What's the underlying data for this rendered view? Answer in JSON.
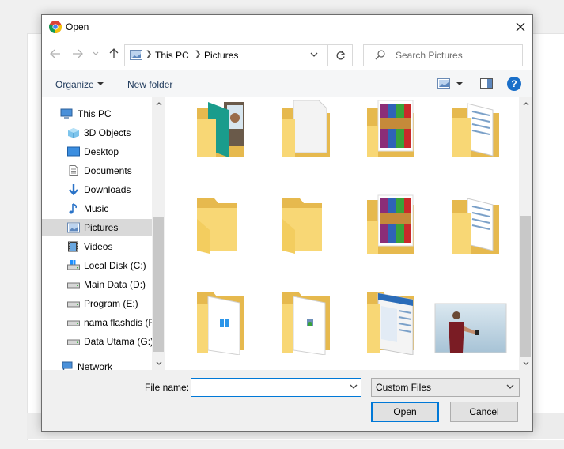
{
  "window": {
    "title": "Open",
    "close_glyph": "✕"
  },
  "nav": {
    "breadcrumb": [
      "This PC",
      "Pictures"
    ],
    "search_placeholder": "Search Pictures"
  },
  "toolbar": {
    "organize": "Organize",
    "new_folder": "New folder",
    "help_glyph": "?"
  },
  "sidebar": {
    "items": [
      {
        "label": "This PC",
        "icon": "computer-icon"
      },
      {
        "label": "3D Objects",
        "icon": "cube-icon"
      },
      {
        "label": "Desktop",
        "icon": "desktop-icon"
      },
      {
        "label": "Documents",
        "icon": "document-icon"
      },
      {
        "label": "Downloads",
        "icon": "download-arrow-icon"
      },
      {
        "label": "Music",
        "icon": "music-note-icon"
      },
      {
        "label": "Pictures",
        "icon": "picture-icon",
        "selected": true
      },
      {
        "label": "Videos",
        "icon": "film-icon"
      },
      {
        "label": "Local Disk (C:)",
        "icon": "windows-drive-icon"
      },
      {
        "label": "Main Data (D:)",
        "icon": "drive-icon"
      },
      {
        "label": "Program (E:)",
        "icon": "drive-icon"
      },
      {
        "label": "nama flashdis (F",
        "icon": "drive-icon"
      },
      {
        "label": "Data Utama (G:)",
        "icon": "drive-icon"
      },
      {
        "label": "Network",
        "icon": "network-icon"
      }
    ]
  },
  "files": [
    {
      "kind": "folder-teal-photo"
    },
    {
      "kind": "folder-white-page"
    },
    {
      "kind": "folder-winrar"
    },
    {
      "kind": "folder-docs"
    },
    {
      "kind": "folder-empty"
    },
    {
      "kind": "folder-empty"
    },
    {
      "kind": "folder-winrar"
    },
    {
      "kind": "folder-docs"
    },
    {
      "kind": "folder-windows-page"
    },
    {
      "kind": "folder-setup-page"
    },
    {
      "kind": "folder-screenshot"
    },
    {
      "kind": "photo-man-phone"
    }
  ],
  "footer": {
    "filename_label": "File name:",
    "filename_value": "",
    "filetype": "Custom Files",
    "open_label": "Open",
    "cancel_label": "Cancel"
  },
  "colors": {
    "accent": "#0078d7",
    "folder": "#f8d775",
    "folder_dark": "#e6b94e",
    "help_blue": "#1a6fc9",
    "selection": "#d9d9d9"
  }
}
